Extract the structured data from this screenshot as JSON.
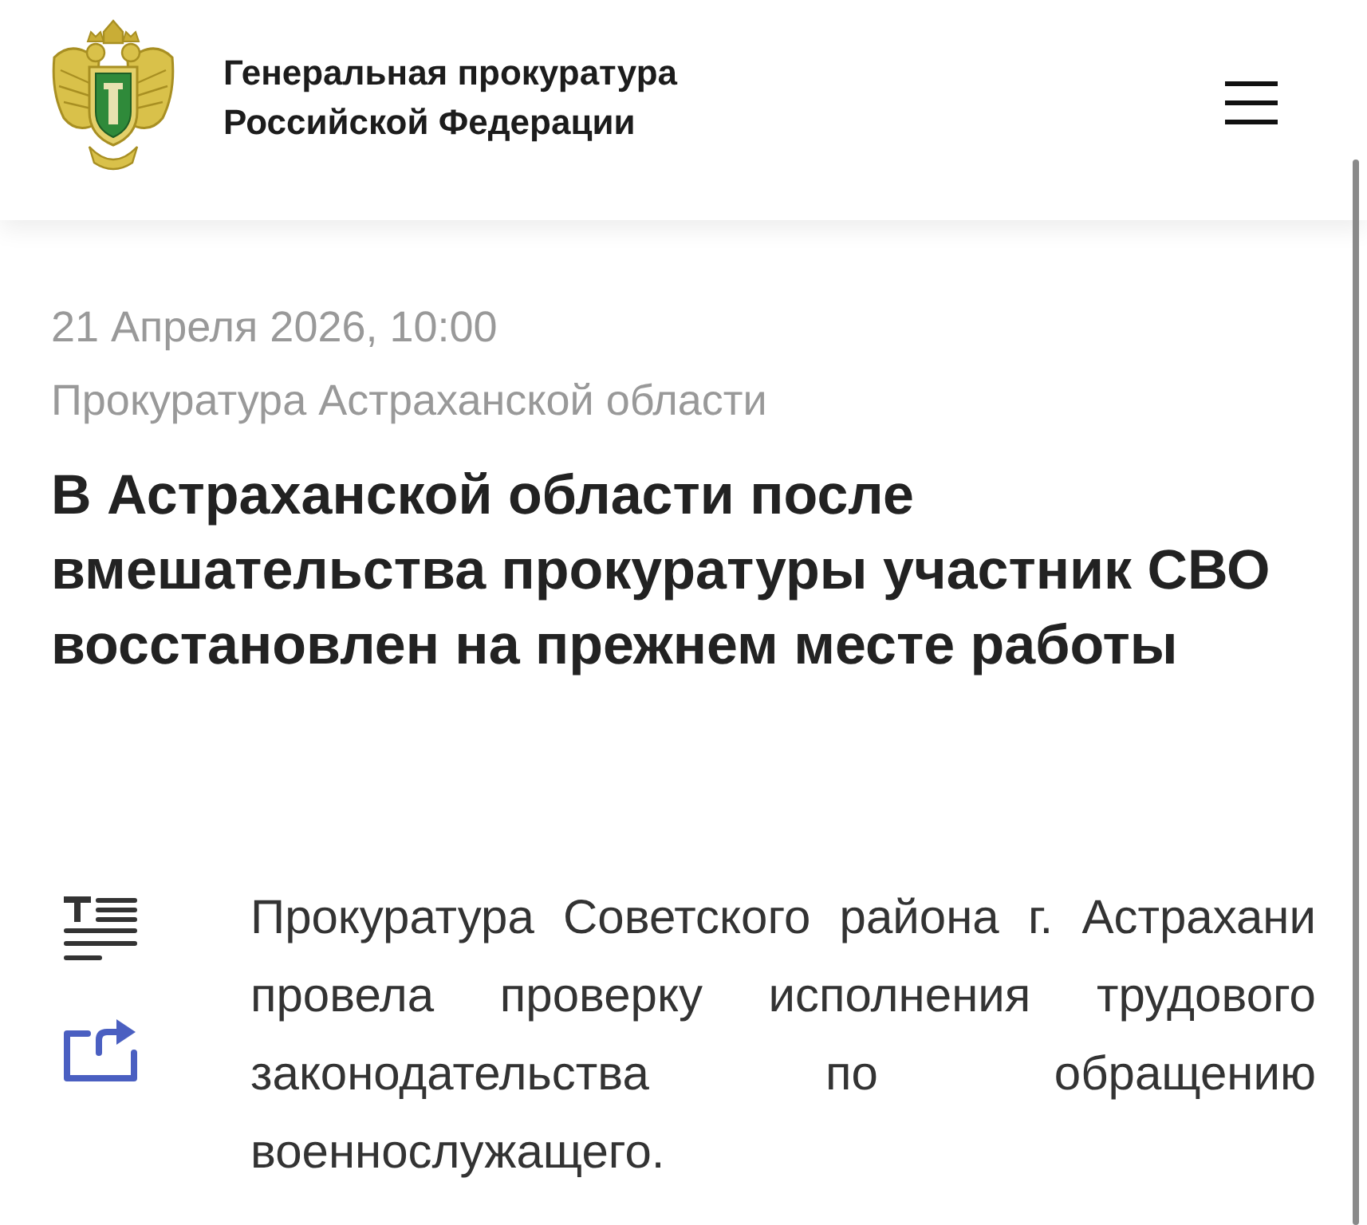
{
  "header": {
    "title_lines": [
      "Генеральная прокуратура",
      "Российской Федерации"
    ]
  },
  "article": {
    "date": "21 Апреля 2026, 10:00",
    "source": "Прокуратура Астраханской области",
    "headline_lines": [
      "В Астраханской области после",
      "вмешательства прокуратуры участник СВО",
      "восстановлен на прежнем месте работы"
    ],
    "body_lines": [
      "Прокуратура Советского района г. Астрахани",
      "провела проверку исполнения трудового",
      "законодательства по обращению",
      "военнослужащего."
    ]
  }
}
